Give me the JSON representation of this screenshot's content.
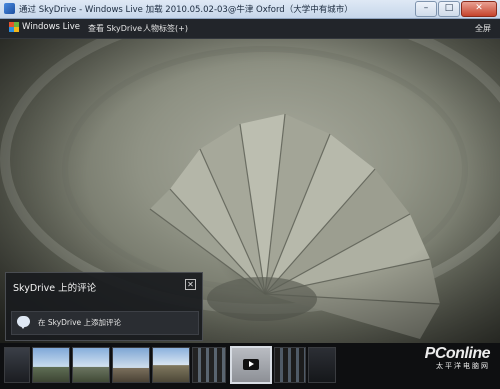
{
  "window": {
    "title": "通过 SkyDrive - Windows Live 加载 2010.05.02-03@牛津 Oxford（大学中有城市）",
    "controls": {
      "minimize": "–",
      "maximize": "□",
      "close": "✕"
    }
  },
  "toolbar": {
    "logo_text": "Windows Live",
    "nav": [
      {
        "label": "查看 SkyDrive"
      },
      {
        "label": "人物标签(+)"
      }
    ],
    "fullscreen_label": "全屏"
  },
  "photo": {
    "subject": "spiral-staircase"
  },
  "comments_panel": {
    "title": "SkyDrive 上的评论",
    "close_symbol": "✕",
    "add_comment_link": "在 SkyDrive 上添加评论"
  },
  "filmstrip": {
    "thumbnails": [
      {
        "kind": "dark"
      },
      {
        "kind": "sky"
      },
      {
        "kind": "sky"
      },
      {
        "kind": "sky"
      },
      {
        "kind": "sky"
      },
      {
        "kind": "window"
      },
      {
        "kind": "video",
        "selected": true
      },
      {
        "kind": "window"
      },
      {
        "kind": "dark"
      }
    ]
  },
  "watermark": {
    "main": "PConline",
    "sub": "太平洋电脑网"
  },
  "colors": {
    "toolbar_bg": "#22252a",
    "panel_bg": "#191b1e",
    "accent": "#d8dde4"
  }
}
